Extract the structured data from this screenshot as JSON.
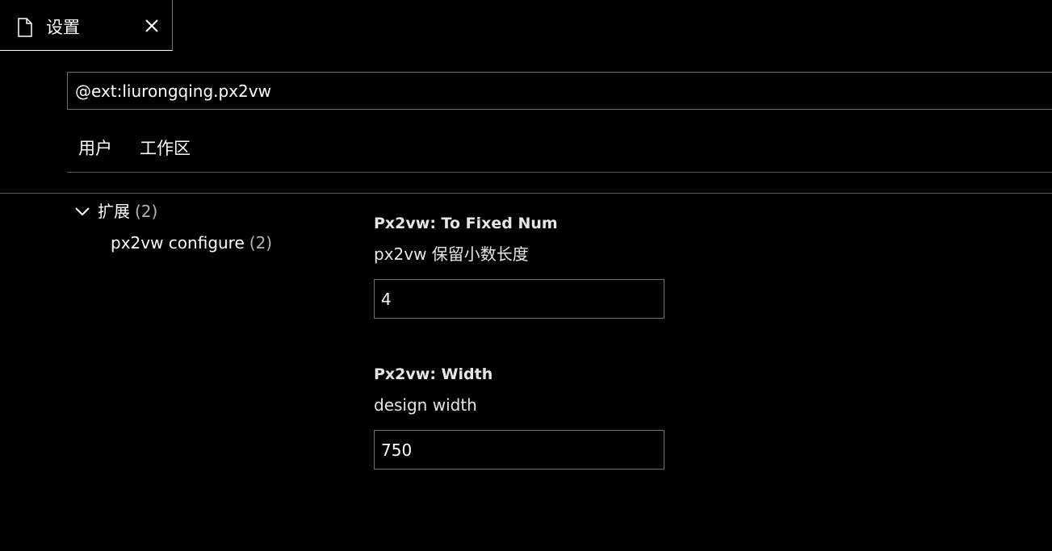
{
  "tab": {
    "title": "设置",
    "file_icon": "file-icon",
    "close_icon": "close-icon"
  },
  "search": {
    "value": "@ext:liurongqing.px2vw"
  },
  "scope_tabs": [
    {
      "label": "用户"
    },
    {
      "label": "工作区"
    }
  ],
  "toc": {
    "group": {
      "label": "扩展",
      "count": "(2)",
      "icon": "chevron-down-icon"
    },
    "items": [
      {
        "label": "px2vw configure",
        "count": "(2)"
      }
    ]
  },
  "settings": [
    {
      "title": "Px2vw: To Fixed Num",
      "description": "px2vw 保留小数长度",
      "value": "4"
    },
    {
      "title": "Px2vw: Width",
      "description": "design width",
      "value": "750"
    }
  ],
  "colors": {
    "background": "#000000",
    "border": "#6f6f6f",
    "text": "#ffffff",
    "muted": "#b4b4b4"
  }
}
